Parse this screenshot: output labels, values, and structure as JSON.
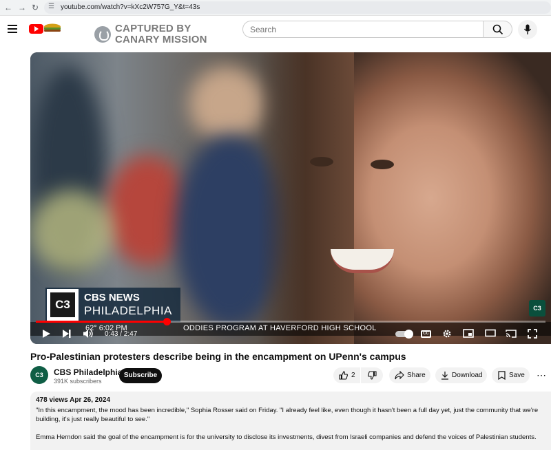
{
  "browser": {
    "url": "youtube.com/watch?v=kXc2W757G_Y&t=43s"
  },
  "header": {
    "watermark_line1": "CAPTURED BY",
    "watermark_line2": "CANARY MISSION",
    "search_placeholder": "Search"
  },
  "player": {
    "lower_third_channel_logo": "C3",
    "lower_third_top": "CBS NEWS",
    "lower_third_bottom": "PHILADELPHIA",
    "ticker_time": "62°   6:02 PM",
    "ticker_text": "ODDIES PROGRAM AT HAVERFORD HIGH SCHOOL",
    "current_time": "0:43",
    "duration": "2:47",
    "time_display": "0:43 / 2:47",
    "progress_fraction": 0.257,
    "station_bug": "C3"
  },
  "video": {
    "title": "Pro-Palestinian protesters describe being in the encampment on UPenn's campus",
    "channel_name": "CBS Philadelphia",
    "channel_subscribers": "391K subscribers",
    "subscribe_label": "Subscribe",
    "likes": "2",
    "share_label": "Share",
    "download_label": "Download",
    "save_label": "Save"
  },
  "description": {
    "meta": "478 views  Apr 26, 2024",
    "paragraph1": "\"In this encampment, the mood has been incredible,\" Sophia Rosser said on Friday. \"I already feel like, even though it hasn't been a full day yet, just the community that we're building, it's just really beautiful to see.\"",
    "paragraph2": "Emma Herndon said the goal of the encampment is for the university to disclose its investments, divest from Israeli companies and defend the voices of Palestinian students."
  },
  "colors": {
    "brand_red": "#ff0000",
    "progress": "#ff0000",
    "subscribe_bg": "#0f0f0f"
  }
}
